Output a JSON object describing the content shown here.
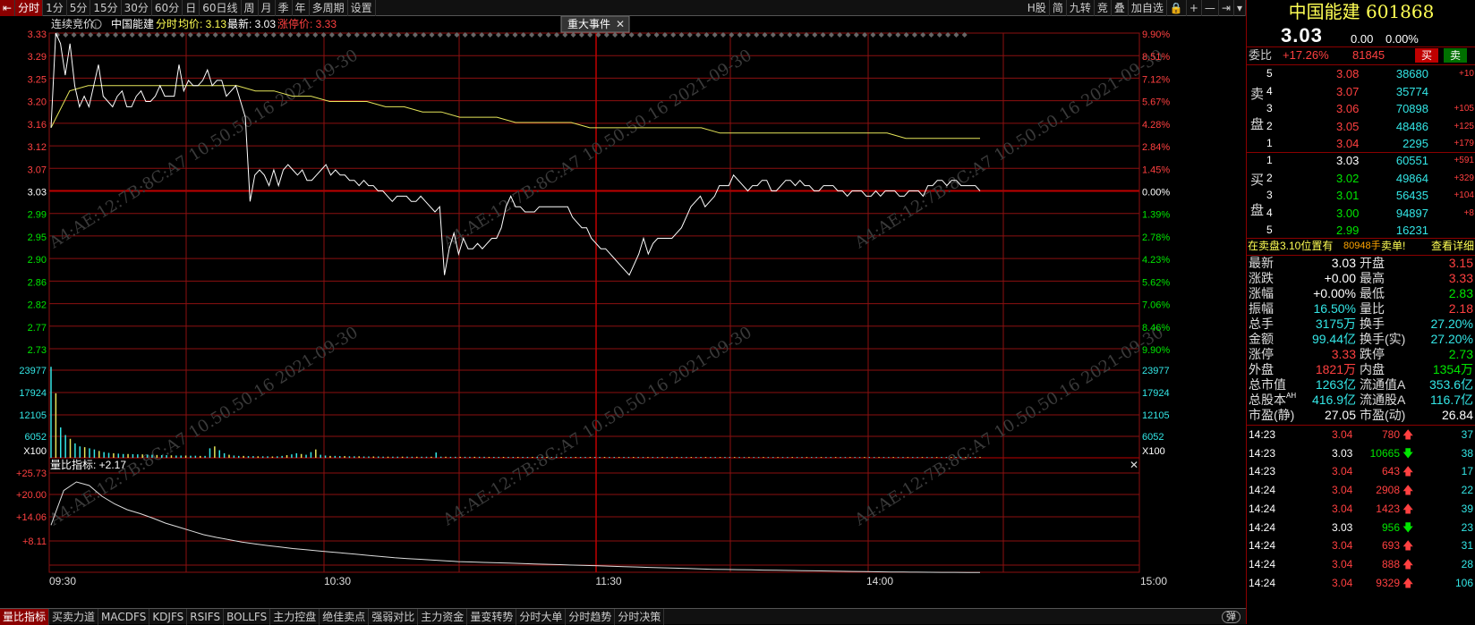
{
  "topbar": {
    "items": [
      "分时",
      "1分",
      "5分",
      "15分",
      "30分",
      "60分",
      "日",
      "60日线",
      "周",
      "月",
      "季",
      "年",
      "多周期",
      "设置"
    ],
    "right_items": [
      "H股",
      "简",
      "九转",
      "竞",
      "叠",
      "加自选",
      "🔒",
      "+",
      "—",
      "⇥",
      "▾"
    ]
  },
  "chart": {
    "legend_auction": "连续竞价",
    "legend_name": "中国能建",
    "legend_mode": "分时",
    "legend_avg": "均价: 3.13",
    "legend_last": "最新: 3.03",
    "legend_limit": "涨停价: 3.33",
    "event_label": "重大事件",
    "price_ticks": [
      "3.33",
      "3.29",
      "3.25",
      "3.20",
      "3.16",
      "3.12",
      "3.07",
      "3.03",
      "2.99",
      "2.95",
      "2.90",
      "2.86",
      "2.82",
      "2.77",
      "2.73"
    ],
    "pct_ticks": [
      "9.90%",
      "8.51%",
      "7.12%",
      "5.67%",
      "4.28%",
      "2.84%",
      "1.45%",
      "0.00%",
      "1.39%",
      "2.78%",
      "4.23%",
      "5.62%",
      "7.06%",
      "8.46%",
      "9.90%"
    ],
    "vol_ticks": [
      "23977",
      "17924",
      "12105",
      "6052"
    ],
    "vol_unit": "X100",
    "ratio_label": "量比指标: +2.17",
    "ratio_ticks": [
      "+25.73",
      "+20.00",
      "+14.06",
      "+8.11"
    ],
    "time_ticks": [
      "09:30",
      "10:30",
      "11:30",
      "14:00",
      "15:00"
    ],
    "watermark": "A4:AE:12:7B:8C:A7  10.50.50.16  2021-09-30"
  },
  "chart_data": {
    "type": "line",
    "ylim": [
      2.73,
      3.33
    ],
    "price_series": [
      3.15,
      3.33,
      3.31,
      3.25,
      3.31,
      3.23,
      3.19,
      3.21,
      3.19,
      3.23,
      3.27,
      3.21,
      3.2,
      3.19,
      3.21,
      3.22,
      3.19,
      3.19,
      3.21,
      3.22,
      3.2,
      3.2,
      3.21,
      3.23,
      3.21,
      3.21,
      3.21,
      3.27,
      3.22,
      3.24,
      3.23,
      3.23,
      3.24,
      3.26,
      3.23,
      3.24,
      3.24,
      3.21,
      3.22,
      3.23,
      3.2,
      3.17,
      3.01,
      3.06,
      3.07,
      3.06,
      3.04,
      3.07,
      3.04,
      3.07,
      3.08,
      3.07,
      3.06,
      3.07,
      3.05,
      3.05,
      3.06,
      3.07,
      3.08,
      3.06,
      3.07,
      3.06,
      3.06,
      3.05,
      3.05,
      3.04,
      3.05,
      3.04,
      3.04,
      3.03,
      3.03,
      3.02,
      3.01,
      3.02,
      3.02,
      3.02,
      3.01,
      3.01,
      3.02,
      3.01,
      3.0,
      2.99,
      3.0,
      2.87,
      2.92,
      2.95,
      2.91,
      2.94,
      2.92,
      2.92,
      2.93,
      2.92,
      2.93,
      2.94,
      2.94,
      2.96,
      3.0,
      3.02,
      3.0,
      3.0,
      2.99,
      2.99,
      2.99,
      3.0,
      3.0,
      3.0,
      3.0,
      3.0,
      3.0,
      3.0,
      2.98,
      2.97,
      2.96,
      2.96,
      2.94,
      2.93,
      2.92,
      2.92,
      2.91,
      2.9,
      2.89,
      2.88,
      2.87,
      2.89,
      2.91,
      2.94,
      2.91,
      2.93,
      2.94,
      2.94,
      2.94,
      2.94,
      2.95,
      2.96,
      2.98,
      3.0,
      3.01,
      3.02,
      3.0,
      3.01,
      3.02,
      3.04,
      3.04,
      3.04,
      3.06,
      3.05,
      3.04,
      3.03,
      3.04,
      3.04,
      3.05,
      3.05,
      3.03,
      3.03,
      3.04,
      3.05,
      3.05,
      3.04,
      3.05,
      3.04,
      3.04,
      3.03,
      3.03,
      3.04,
      3.04,
      3.04,
      3.03,
      3.03,
      3.02,
      3.03,
      3.03,
      3.03,
      3.02,
      3.02,
      3.03,
      3.02,
      3.03,
      3.03,
      3.03,
      3.02,
      3.02,
      3.03,
      3.03,
      3.03,
      3.02,
      3.04,
      3.04,
      3.05,
      3.05,
      3.04,
      3.05,
      3.05,
      3.04,
      3.04,
      3.04,
      3.04,
      3.03
    ],
    "avg_series": [
      3.15,
      3.22,
      3.23,
      3.23,
      3.23,
      3.23,
      3.23,
      3.23,
      3.23,
      3.23,
      3.23,
      3.22,
      3.22,
      3.21,
      3.21,
      3.2,
      3.2,
      3.2,
      3.19,
      3.19,
      3.18,
      3.18,
      3.17,
      3.17,
      3.17,
      3.16,
      3.16,
      3.16,
      3.16,
      3.15,
      3.15,
      3.15,
      3.15,
      3.15,
      3.15,
      3.15,
      3.14,
      3.14,
      3.14,
      3.14,
      3.14,
      3.14,
      3.14,
      3.14,
      3.14,
      3.14,
      3.13,
      3.13,
      3.13,
      3.13,
      3.13
    ],
    "volume_series": [
      23977,
      17000,
      8000,
      6000,
      5000,
      3800,
      3000,
      2800,
      2500,
      2200,
      1800,
      1500,
      1300,
      1200,
      1100,
      1000,
      1000,
      950,
      900,
      900,
      800,
      800,
      750,
      700,
      700,
      650,
      600,
      600,
      600,
      550,
      550,
      500,
      500,
      2500,
      3000,
      2000,
      1200,
      800,
      600,
      500,
      500,
      450,
      450,
      400,
      400,
      400,
      350,
      400,
      500,
      700,
      900,
      1200,
      1000,
      800,
      1500,
      2200,
      800,
      600,
      500,
      500,
      450,
      450,
      400,
      400,
      400,
      350,
      350,
      350,
      350,
      300,
      300,
      300,
      300,
      300,
      300,
      280,
      280,
      280,
      280,
      280,
      1400,
      300,
      280,
      260,
      260,
      260,
      260,
      260,
      260,
      260,
      260,
      240,
      240,
      240,
      240,
      240,
      240,
      240,
      240,
      240,
      240,
      230,
      230,
      230,
      230,
      230,
      230,
      220,
      220,
      220,
      220,
      220,
      220,
      220,
      220,
      220,
      220,
      220,
      220,
      220,
      220,
      220,
      220,
      210,
      210,
      210,
      210,
      210,
      210,
      210,
      210,
      210,
      210,
      210,
      210,
      210,
      210,
      210,
      210,
      210,
      210,
      210,
      200,
      200,
      200,
      200,
      200,
      200,
      200,
      200,
      200,
      200,
      200,
      200,
      200,
      200,
      200,
      200,
      200,
      200,
      200,
      200,
      200,
      200,
      200,
      200,
      200,
      200,
      200,
      200,
      200,
      200,
      200,
      200,
      200,
      200,
      200,
      200,
      200,
      200,
      200,
      200,
      200,
      200,
      200,
      200,
      200,
      200,
      200,
      200,
      200,
      200,
      200,
      200
    ],
    "ratio_series": [
      14.5,
      23.5,
      25.73,
      24.8,
      22,
      20,
      18.5,
      17.5,
      16.3,
      15,
      14,
      13,
      12,
      11.3,
      10.7,
      10.1,
      9.6,
      9.2,
      8.8,
      8.4,
      8.1,
      7.8,
      7.5,
      7.2,
      6.9,
      6.6,
      6.3,
      6,
      5.8,
      5.6,
      5.4,
      5.2,
      5,
      4.9,
      4.8,
      4.7,
      4.6,
      4.5,
      4.4,
      4.3,
      4.2,
      4.1,
      4,
      3.9,
      3.8,
      3.7,
      3.6,
      3.5,
      3.4,
      3.3,
      3.2,
      3.1,
      3,
      2.95,
      2.9,
      2.85,
      2.8,
      2.75,
      2.7,
      2.65,
      2.6,
      2.55,
      2.5,
      2.45,
      2.4,
      2.35,
      2.3,
      2.28,
      2.26,
      2.24,
      2.22,
      2.2,
      2.18,
      2.17
    ]
  },
  "panel": {
    "name": "中国能建 601868",
    "price": "3.03",
    "chg": "0.00",
    "pct": "0.00%",
    "weibi_label": "委比",
    "weibi_val": "+17.26%",
    "weibi_diff": "81845",
    "buy_btn": "买",
    "sell_btn": "卖",
    "sell_label": [
      "卖",
      "盘"
    ],
    "buy_label": [
      "买",
      "盘"
    ],
    "asks": [
      {
        "lv": "5",
        "p": "3.08",
        "v": "38680",
        "d": "+10"
      },
      {
        "lv": "4",
        "p": "3.07",
        "v": "35774",
        "d": ""
      },
      {
        "lv": "3",
        "p": "3.06",
        "v": "70898",
        "d": "+105"
      },
      {
        "lv": "2",
        "p": "3.05",
        "v": "48486",
        "d": "+125"
      },
      {
        "lv": "1",
        "p": "3.04",
        "v": "2295",
        "d": "+179"
      }
    ],
    "bids": [
      {
        "lv": "1",
        "p": "3.03",
        "v": "60551",
        "d": "+591"
      },
      {
        "lv": "2",
        "p": "3.02",
        "v": "49864",
        "d": "+329"
      },
      {
        "lv": "3",
        "p": "3.01",
        "v": "56435",
        "d": "+104"
      },
      {
        "lv": "4",
        "p": "3.00",
        "v": "94897",
        "d": "+8"
      },
      {
        "lv": "5",
        "p": "2.99",
        "v": "16231",
        "d": ""
      }
    ],
    "notice_a": "在卖盘3.10位置有",
    "notice_b": "80948手",
    "notice_c": "卖单!",
    "notice_link": "查看详细",
    "stats": [
      [
        "最新",
        "3.03",
        "开盘",
        "3.15"
      ],
      [
        "涨跌",
        "+0.00",
        "最高",
        "3.33"
      ],
      [
        "涨幅",
        "+0.00%",
        "最低",
        "2.83"
      ],
      [
        "振幅",
        "16.50%",
        "量比",
        "2.18"
      ],
      [
        "总手",
        "3175万",
        "换手",
        "27.20%"
      ],
      [
        "金额",
        "99.44亿",
        "换手(实)",
        "27.20%"
      ],
      [
        "涨停",
        "3.33",
        "跌停",
        "2.73"
      ],
      [
        "外盘",
        "1821万",
        "内盘",
        "1354万"
      ],
      [
        "总市值",
        "1263亿",
        "流通值A",
        "353.6亿"
      ],
      [
        "总股本",
        "416.9亿",
        "流通股A",
        "116.7亿"
      ],
      [
        "市盈(静)",
        "27.05",
        "市盈(动)",
        "26.84"
      ]
    ],
    "stat_ah": "AH",
    "ticks": [
      {
        "t": "14:23",
        "p": "3.04",
        "v": "780",
        "dir": "up",
        "n": "37"
      },
      {
        "t": "14:23",
        "p": "3.03",
        "v": "10665",
        "dir": "down",
        "n": "38"
      },
      {
        "t": "14:23",
        "p": "3.04",
        "v": "643",
        "dir": "up",
        "n": "17"
      },
      {
        "t": "14:24",
        "p": "3.04",
        "v": "2908",
        "dir": "up",
        "n": "22"
      },
      {
        "t": "14:24",
        "p": "3.04",
        "v": "1423",
        "dir": "up",
        "n": "39"
      },
      {
        "t": "14:24",
        "p": "3.03",
        "v": "956",
        "dir": "down",
        "n": "23"
      },
      {
        "t": "14:24",
        "p": "3.04",
        "v": "693",
        "dir": "up",
        "n": "31"
      },
      {
        "t": "14:24",
        "p": "3.04",
        "v": "888",
        "dir": "up",
        "n": "28"
      },
      {
        "t": "14:24",
        "p": "3.04",
        "v": "9329",
        "dir": "up",
        "n": "106"
      }
    ]
  },
  "bottombar": {
    "items": [
      "量比指标",
      "买卖力道",
      "MACDFS",
      "KDJFS",
      "RSIFS",
      "BOLLFS",
      "主力控盘",
      "绝佳卖点",
      "强弱对比",
      "主力资金",
      "量变转势",
      "分时大单",
      "分时趋势",
      "分时决策"
    ],
    "toggle": "弹"
  }
}
